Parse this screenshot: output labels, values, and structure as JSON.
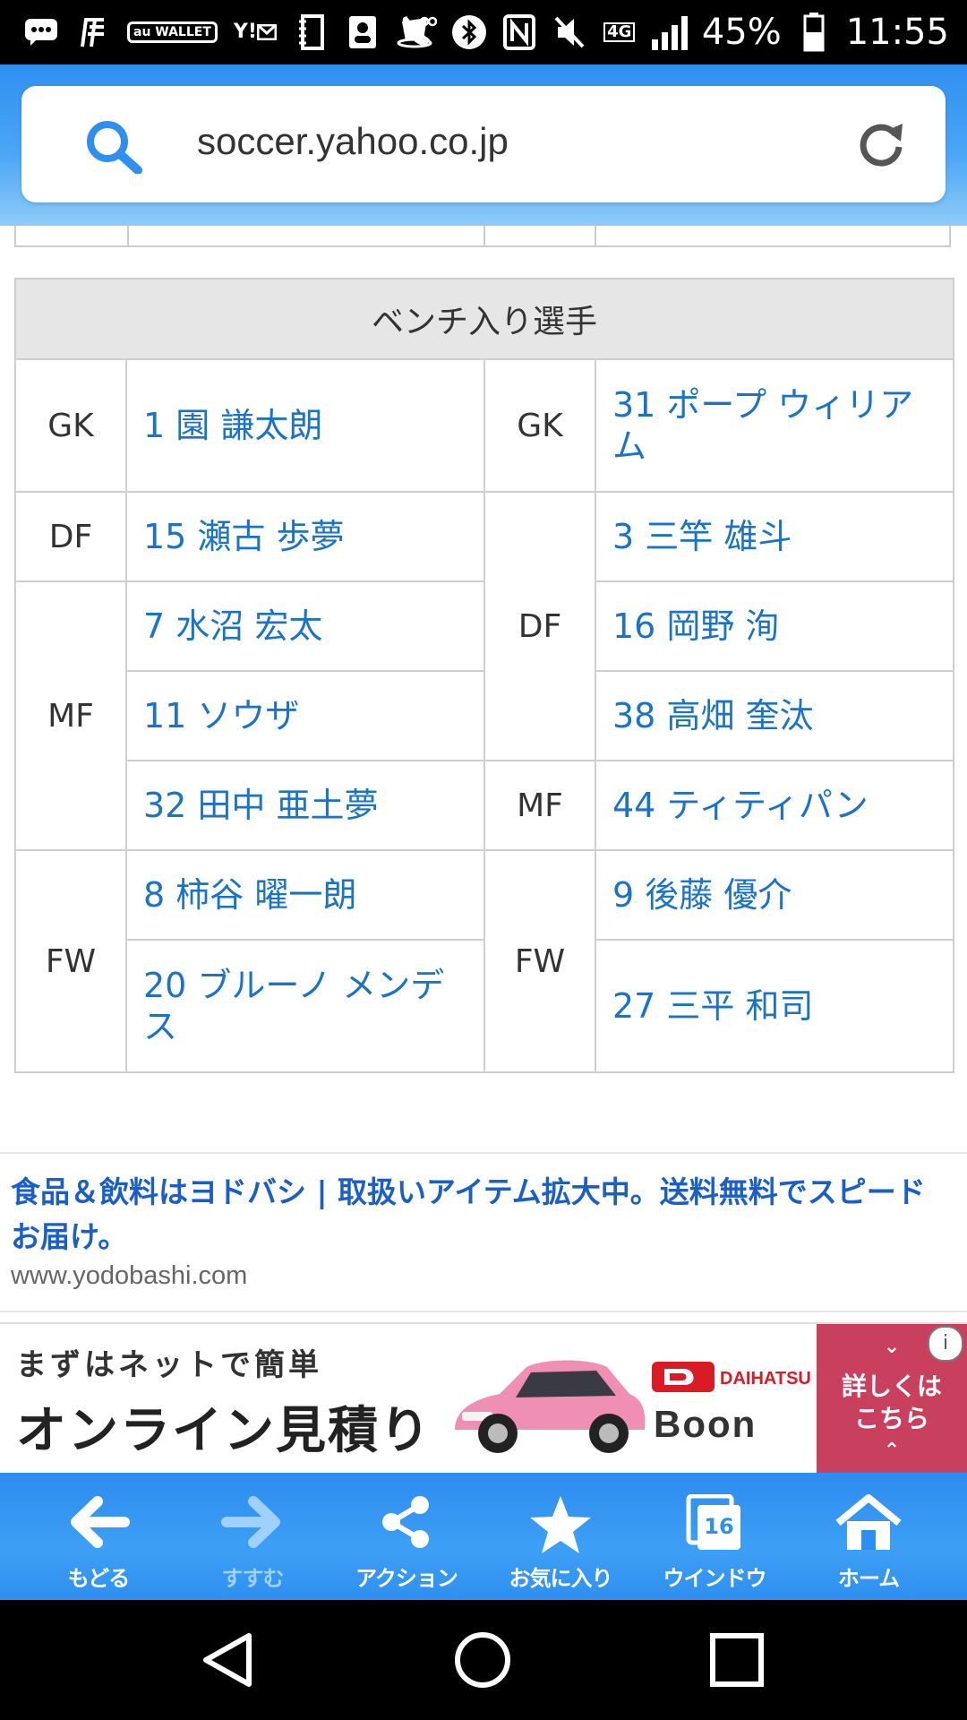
{
  "status_bar": {
    "battery": "45%",
    "time": "11:55",
    "network": "4G",
    "app_badges": [
      "au WALLET",
      "Y!"
    ]
  },
  "browser": {
    "url": "soccer.yahoo.co.jp"
  },
  "bench": {
    "title": "ベンチ入り選手",
    "rows": [
      {
        "left_pos": "GK",
        "left_player": "1 園 謙太朗",
        "right_pos": "GK",
        "right_player": "31 ポープ ウィリアム"
      },
      {
        "left_pos": "DF",
        "left_player": "15 瀬古 歩夢",
        "right_player": "3 三竿 雄斗"
      },
      {
        "left_pos": "MF",
        "left_player": "7 水沼 宏太",
        "right_pos": "DF",
        "right_player": "16 岡野 洵"
      },
      {
        "left_player": "11 ソウザ",
        "right_player": "38 高畑 奎汰"
      },
      {
        "left_player": "32 田中 亜土夢",
        "right_pos": "MF",
        "right_player": "44 ティティパン"
      },
      {
        "left_pos": "FW",
        "left_player": "8 柿谷 曜一朗",
        "right_pos": "FW",
        "right_player": "9 後藤 優介"
      },
      {
        "left_player": "20 ブルーノ メンデス",
        "right_player": "27 三平 和司"
      }
    ]
  },
  "text_ad": {
    "title": "食品＆飲料はヨドバシ | 取扱いアイテム拡大中。送料無料でスピードお届け。",
    "url": "www.yodobashi.com"
  },
  "banner_ad": {
    "line1": "まずはネットで簡単",
    "line2": "オンライン見積り",
    "brand": "DAIHATSU",
    "model": "Boon",
    "cta_line1": "詳しくは",
    "cta_line2": "こちら"
  },
  "toolbar": {
    "back": "もどる",
    "forward": "すすむ",
    "action": "アクション",
    "favorites": "お気に入り",
    "window": "ウインドウ",
    "window_count": "16",
    "home": "ホーム"
  },
  "colors": {
    "link": "#1a73c7",
    "toolbar": "#2f8ff0",
    "ad_title": "#1a5fc8",
    "cta": "#c9405e"
  }
}
